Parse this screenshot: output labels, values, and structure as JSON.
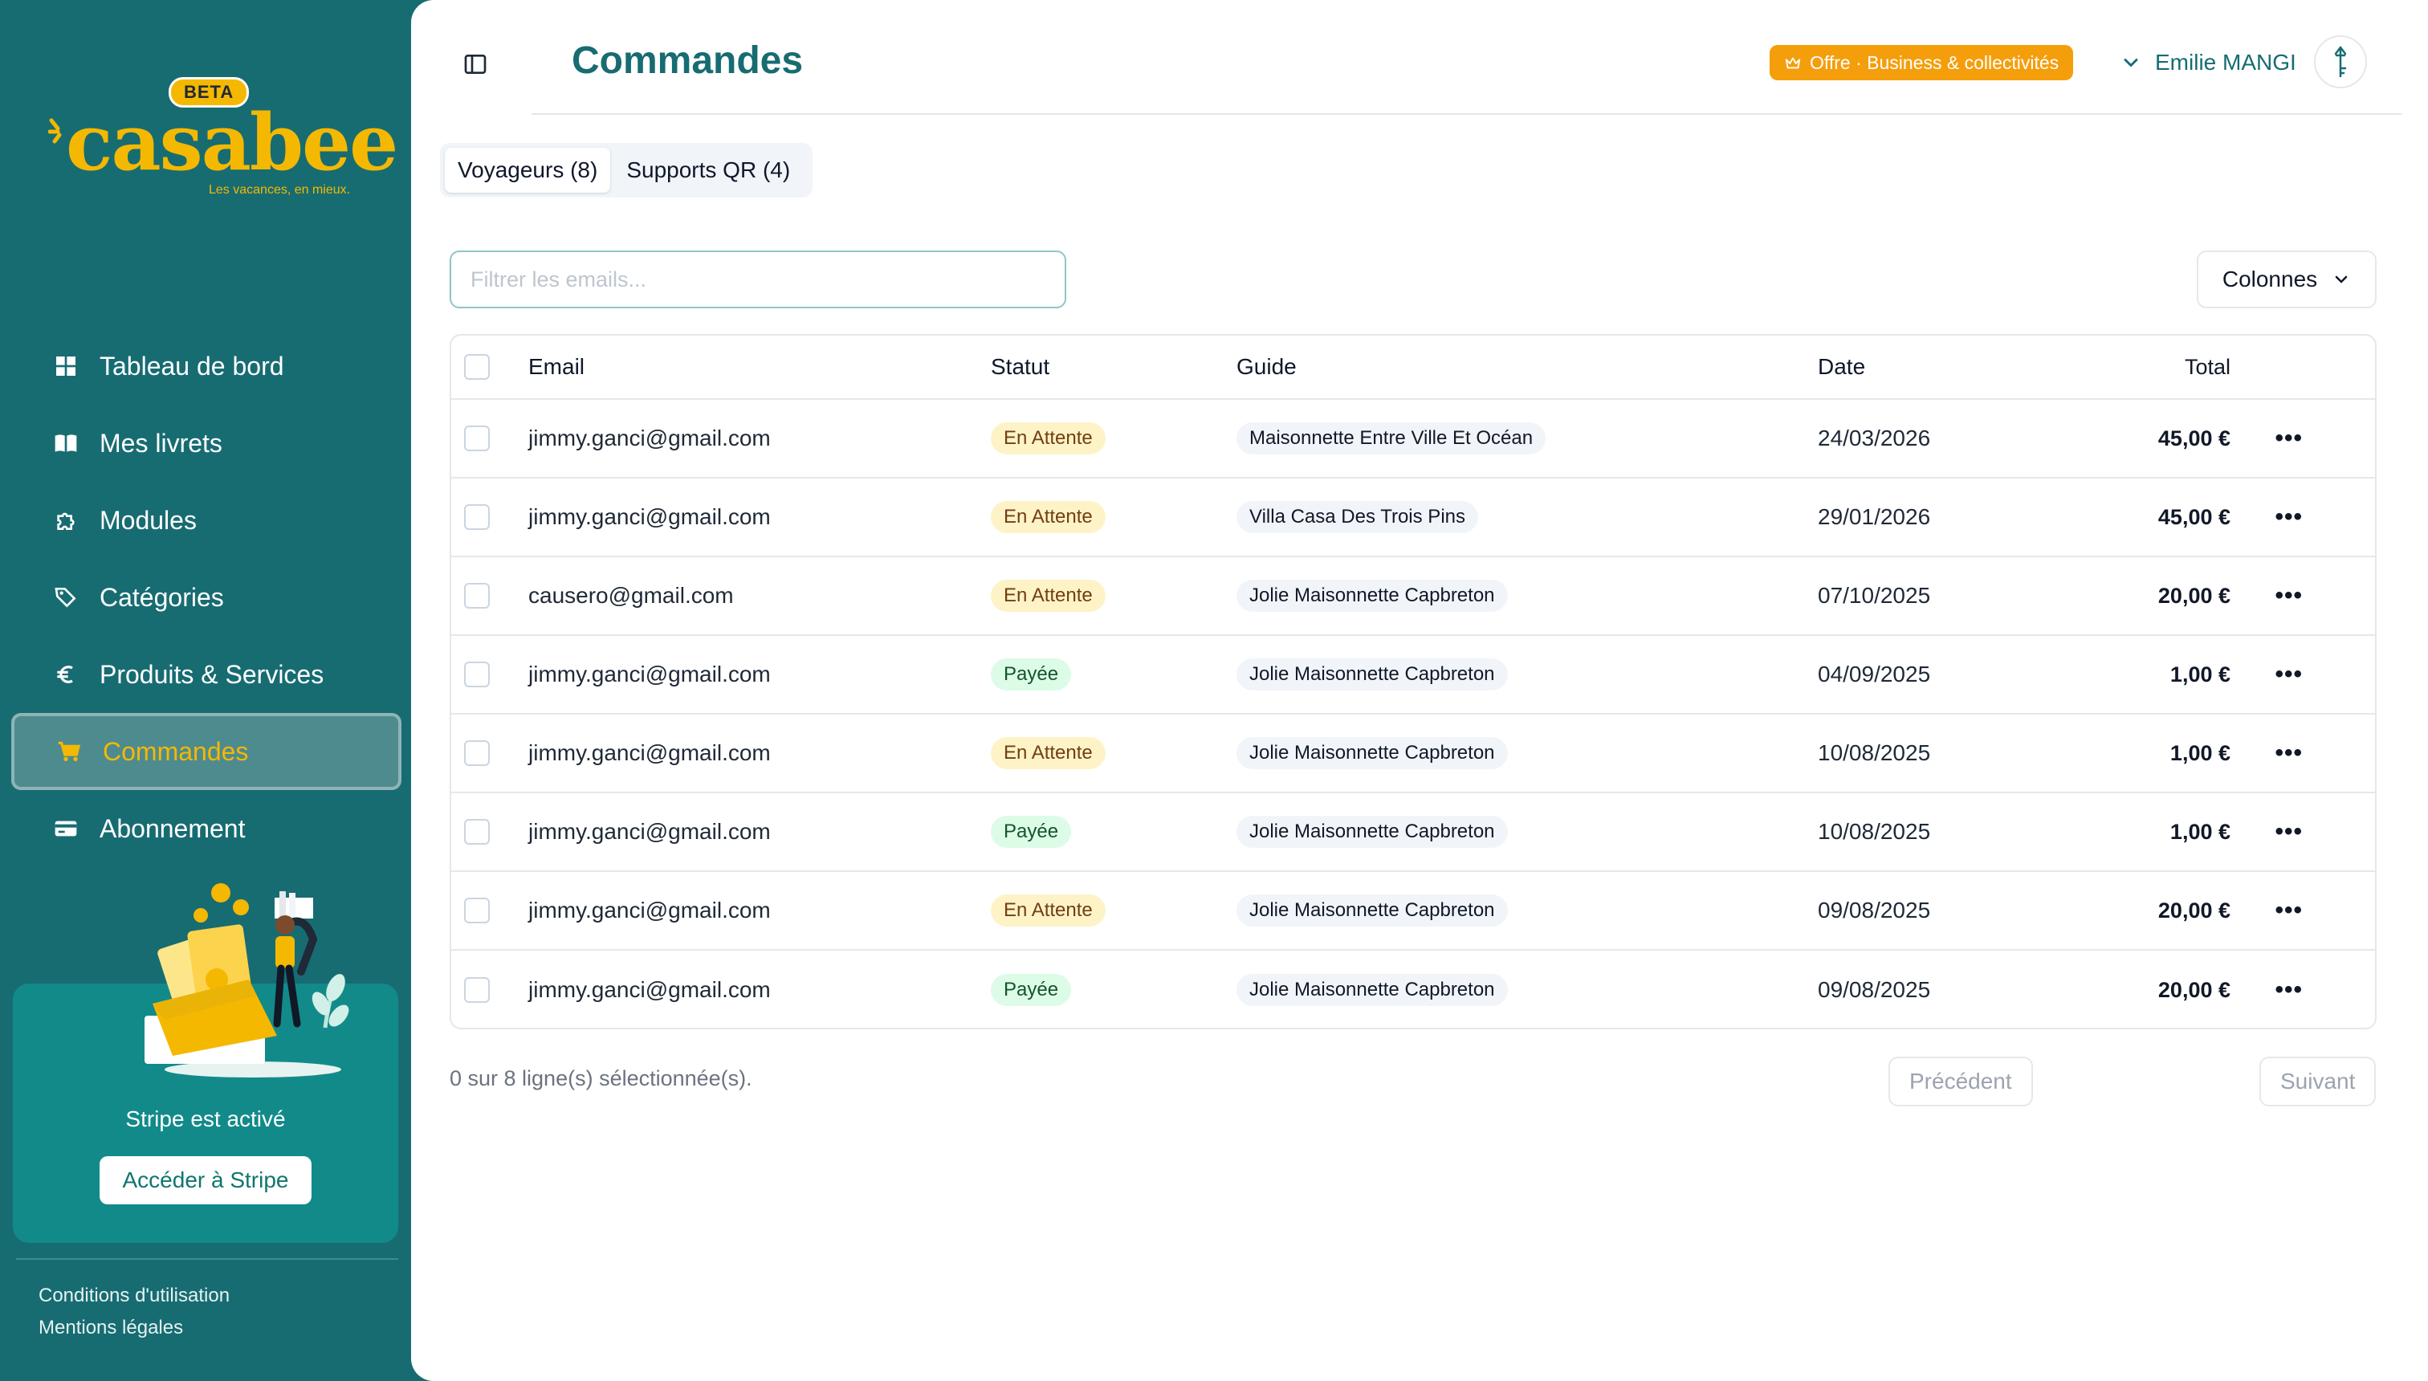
{
  "brand": {
    "badge": "BETA",
    "name": "casabee",
    "tagline": "Les vacances, en mieux.",
    "accent_color": "#f5b800",
    "sidebar_color": "#176c72"
  },
  "sidebar": {
    "items": [
      {
        "label": "Tableau de bord",
        "icon": "dashboard-icon",
        "active": false
      },
      {
        "label": "Mes livrets",
        "icon": "book-icon",
        "active": false
      },
      {
        "label": "Modules",
        "icon": "puzzle-icon",
        "active": false
      },
      {
        "label": "Catégories",
        "icon": "tags-icon",
        "active": false
      },
      {
        "label": "Produits & Services",
        "icon": "euro-icon",
        "active": false
      },
      {
        "label": "Commandes",
        "icon": "cart-icon",
        "active": true
      },
      {
        "label": "Abonnement",
        "icon": "credit-card-icon",
        "active": false
      }
    ],
    "promo": {
      "title": "Stripe est activé",
      "button": "Accéder à Stripe"
    },
    "footer": {
      "terms": "Conditions d'utilisation",
      "legal": "Mentions légales"
    }
  },
  "header": {
    "title": "Commandes",
    "offer": "Offre · Business & collectivités",
    "user": "Emilie MANGI"
  },
  "tabs": [
    {
      "label": "Voyageurs (8)",
      "active": true
    },
    {
      "label": "Supports QR (4)",
      "active": false
    }
  ],
  "filter": {
    "placeholder": "Filtrer les emails..."
  },
  "columns_button": "Colonnes",
  "table": {
    "headers": {
      "email": "Email",
      "status": "Statut",
      "guide": "Guide",
      "date": "Date",
      "total": "Total"
    },
    "rows": [
      {
        "email": "jimmy.ganci@gmail.com",
        "status": "En Attente",
        "status_type": "wait",
        "guide": "Maisonnette Entre Ville Et Océan",
        "date": "24/03/2026",
        "total": "45,00 €"
      },
      {
        "email": "jimmy.ganci@gmail.com",
        "status": "En Attente",
        "status_type": "wait",
        "guide": "Villa Casa Des Trois Pins",
        "date": "29/01/2026",
        "total": "45,00 €"
      },
      {
        "email": "causero@gmail.com",
        "status": "En Attente",
        "status_type": "wait",
        "guide": "Jolie Maisonnette Capbreton",
        "date": "07/10/2025",
        "total": "20,00 €"
      },
      {
        "email": "jimmy.ganci@gmail.com",
        "status": "Payée",
        "status_type": "paid",
        "guide": "Jolie Maisonnette Capbreton",
        "date": "04/09/2025",
        "total": "1,00 €"
      },
      {
        "email": "jimmy.ganci@gmail.com",
        "status": "En Attente",
        "status_type": "wait",
        "guide": "Jolie Maisonnette Capbreton",
        "date": "10/08/2025",
        "total": "1,00 €"
      },
      {
        "email": "jimmy.ganci@gmail.com",
        "status": "Payée",
        "status_type": "paid",
        "guide": "Jolie Maisonnette Capbreton",
        "date": "10/08/2025",
        "total": "1,00 €"
      },
      {
        "email": "jimmy.ganci@gmail.com",
        "status": "En Attente",
        "status_type": "wait",
        "guide": "Jolie Maisonnette Capbreton",
        "date": "09/08/2025",
        "total": "20,00 €"
      },
      {
        "email": "jimmy.ganci@gmail.com",
        "status": "Payée",
        "status_type": "paid",
        "guide": "Jolie Maisonnette Capbreton",
        "date": "09/08/2025",
        "total": "20,00 €"
      }
    ]
  },
  "footer": {
    "selection": "0 sur 8 ligne(s) sélectionnée(s).",
    "prev": "Précédent",
    "next": "Suivant"
  }
}
